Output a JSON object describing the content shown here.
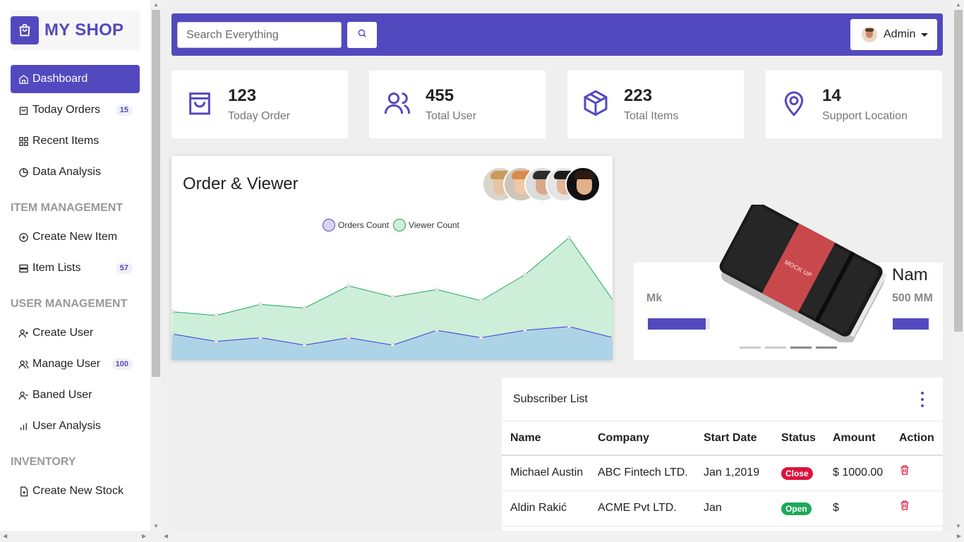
{
  "brand": {
    "name": "MY SHOP"
  },
  "sidebar": {
    "items": [
      {
        "label": "Dashboard",
        "icon": "home-icon",
        "active": true
      },
      {
        "label": "Today Orders",
        "icon": "bag-icon",
        "badge": "15"
      },
      {
        "label": "Recent Items",
        "icon": "grid-icon"
      },
      {
        "label": "Data Analysis",
        "icon": "pie-chart-icon"
      }
    ],
    "sections": [
      {
        "title": "ITEM MANAGEMENT",
        "items": [
          {
            "label": "Create New Item",
            "icon": "plus-circle-icon"
          },
          {
            "label": "Item Lists",
            "icon": "server-icon",
            "badge": "57"
          }
        ]
      },
      {
        "title": "USER MANAGEMENT",
        "items": [
          {
            "label": "Create User",
            "icon": "user-plus-icon"
          },
          {
            "label": "Manage User",
            "icon": "users-icon",
            "badge": "100"
          },
          {
            "label": "Baned User",
            "icon": "user-minus-icon"
          },
          {
            "label": "User Analysis",
            "icon": "bar-chart-icon"
          }
        ]
      },
      {
        "title": "INVENTORY",
        "items": [
          {
            "label": "Create New Stock",
            "icon": "file-plus-icon"
          }
        ]
      }
    ]
  },
  "topbar": {
    "search_placeholder": "Search Everything",
    "admin_label": "Admin"
  },
  "stats": [
    {
      "value": "123",
      "label": "Today Order",
      "icon": "bag-icon"
    },
    {
      "value": "455",
      "label": "Total User",
      "icon": "users-icon"
    },
    {
      "value": "223",
      "label": "Total Items",
      "icon": "box-icon"
    },
    {
      "value": "14",
      "label": "Support Location",
      "icon": "map-pin-icon"
    }
  ],
  "chart": {
    "title": "Order & Viewer",
    "legend": [
      "Orders Count",
      "Viewer Count"
    ]
  },
  "chart_data": {
    "type": "area",
    "title": "Order & Viewer",
    "x": [
      1,
      2,
      3,
      4,
      5,
      6,
      7,
      8,
      9,
      10,
      11
    ],
    "series": [
      {
        "name": "Viewer Count",
        "values": [
          65,
          60,
          75,
          70,
          100,
          85,
          95,
          80,
          115,
          165,
          80
        ],
        "color": "#1fa85a"
      },
      {
        "name": "Orders Count",
        "values": [
          35,
          25,
          30,
          20,
          30,
          20,
          40,
          30,
          40,
          45,
          30
        ],
        "color": "#3b3bd6"
      }
    ],
    "ylim": [
      0,
      180
    ],
    "grid": false,
    "legend_position": "top-center"
  },
  "carousel": {
    "left_name": "",
    "left_sub": "Mk",
    "right_name": "Nam",
    "right_sub": "500 MM",
    "dots": 4,
    "active_dot": 2,
    "product_label": "MOCK UP"
  },
  "subscribers": {
    "title": "Subscriber List",
    "columns": [
      "Name",
      "Company",
      "Start Date",
      "Status",
      "Amount",
      "Action"
    ],
    "rows": [
      {
        "name": "Michael Austin",
        "company": "ABC Fintech LTD.",
        "start": "Jan 1,2019",
        "status": "Close",
        "amount": "$ 1000.00"
      },
      {
        "name": "Aldin Rakić",
        "company": "ACME Pvt LTD.",
        "start": "Jan",
        "status": "Open",
        "amount": "$"
      }
    ]
  },
  "colors": {
    "accent": "#5349bf",
    "close": "#dc143c",
    "open": "#1fa85a"
  }
}
